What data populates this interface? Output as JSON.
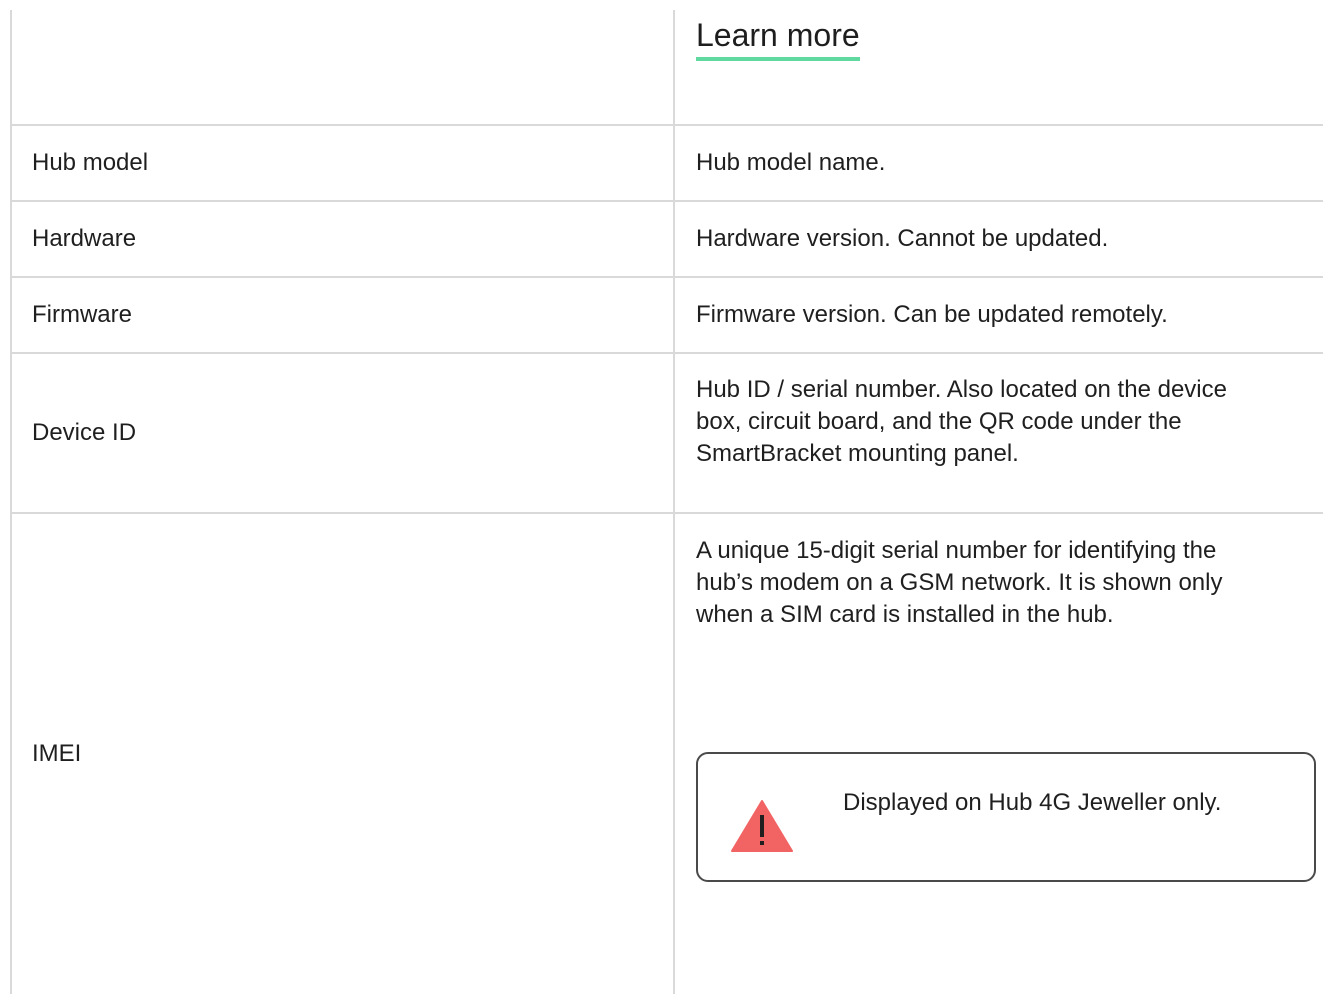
{
  "header": {
    "learn_more": "Learn more"
  },
  "rows": [
    {
      "label": "Hub model",
      "description": "Hub model name."
    },
    {
      "label": "Hardware",
      "description": "Hardware version. Cannot be updated."
    },
    {
      "label": "Firmware",
      "description": "Firmware version. Can be updated remotely."
    },
    {
      "label": "Device ID",
      "description_lines": [
        "Hub ID / serial number. Also located on the device",
        "box, circuit board, and the QR code under the",
        "SmartBracket mounting panel."
      ]
    },
    {
      "label": "IMEI",
      "description_lines": [
        "A unique 15-digit serial number for identifying the",
        "hub’s modem on a GSM network. It is shown only",
        "when a SIM card is installed in the hub."
      ]
    }
  ],
  "note": {
    "icon": "warning-triangle-icon",
    "text": "Displayed on Hub 4G Jeweller only.",
    "icon_color": "#f26363"
  },
  "colors": {
    "accent_underline": "#5fd9a0",
    "grid": "#d9d9d9"
  }
}
